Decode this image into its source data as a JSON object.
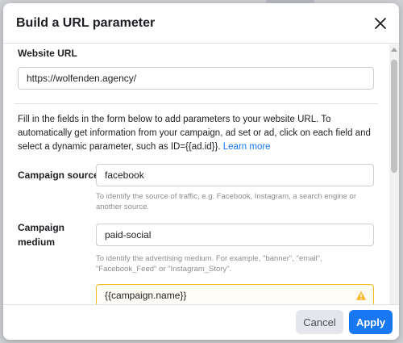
{
  "dialog": {
    "title": "Build a URL parameter",
    "close_icon": "close-icon"
  },
  "website_url": {
    "label": "Website URL",
    "value": "https://wolfenden.agency/"
  },
  "intro": {
    "text": "Fill in the fields in the form below to add parameters to your website URL. To automatically get information from your campaign, ad set or ad, click on each field and select a dynamic parameter, such as ID={{ad.id}}.",
    "link": "Learn more"
  },
  "campaign_source": {
    "label": "Campaign source",
    "value": "facebook",
    "helper": "To identify the source of traffic, e.g. Facebook, Instagram, a search engine or another source."
  },
  "campaign_medium": {
    "label_line1": "Campaign",
    "label_line2": "medium",
    "value": "paid-social",
    "helper": "To identify the advertising medium. For example, \"banner\", \"email\", \"Facebook_Feed\" or \"Instagram_Story\"."
  },
  "campaign_name": {
    "value": "{{campaign.name}}",
    "status_icon": "warning-icon",
    "warning_color": "#f7b928"
  },
  "footer": {
    "cancel_label": "Cancel",
    "apply_label": "Apply"
  },
  "colors": {
    "accent": "#1877f2"
  }
}
